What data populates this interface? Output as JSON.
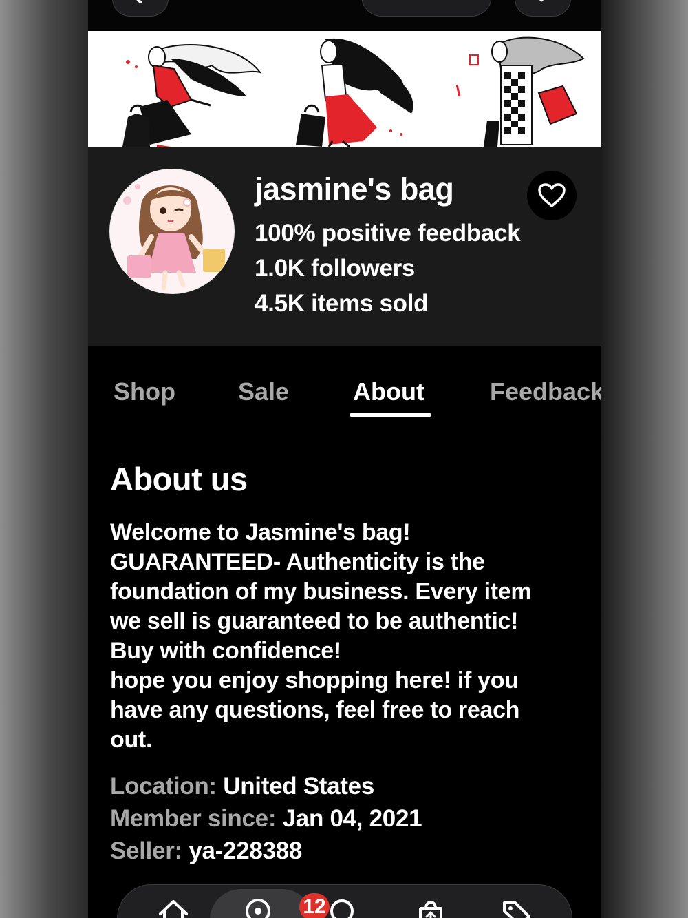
{
  "shop": {
    "name": "jasmine's bag",
    "feedback": "100% positive feedback",
    "followers": "1.0K followers",
    "items_sold": "4.5K items sold"
  },
  "tabs": [
    {
      "label": "Shop"
    },
    {
      "label": "Sale"
    },
    {
      "label": "About",
      "active": true
    },
    {
      "label": "Feedback"
    }
  ],
  "about": {
    "title": "About us",
    "lines": [
      "Welcome to Jasmine's bag!",
      "GUARANTEED- Authenticity is the",
      "foundation of my business. Every item",
      "we sell is guaranteed to be authentic!",
      "Buy with confidence!",
      "hope you enjoy shopping here! if you",
      "have any questions, feel free to reach",
      "out."
    ],
    "location_label": "Location:",
    "location_value": "United States",
    "member_label": "Member since:",
    "member_value": "Jan 04, 2021",
    "seller_label": "Seller:",
    "seller_value": "ya-228388"
  },
  "bottom_nav": {
    "badge_count": "12",
    "icons": [
      "home-icon",
      "explore-icon",
      "search-icon",
      "selling-icon",
      "deals-icon"
    ]
  },
  "colors": {
    "page_bg": "#000000",
    "profile_bg": "#1b1b1b",
    "muted_text": "#a8a8a8",
    "badge": "#e0312b",
    "banner_accent": "#e3242b"
  }
}
